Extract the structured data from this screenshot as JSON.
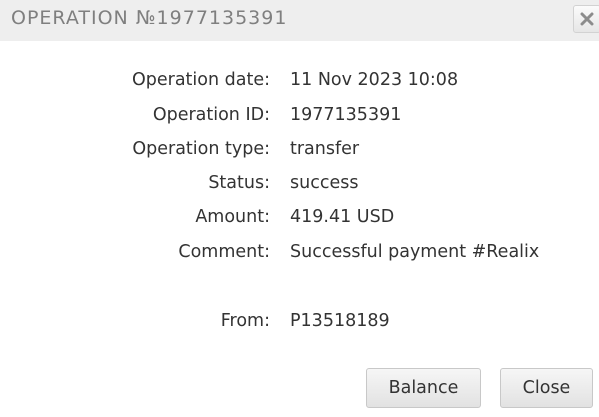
{
  "dialog": {
    "title": "OPERATION №1977135391",
    "close_icon": "close-x-icon"
  },
  "details": [
    {
      "label": "Operation date:",
      "value": "11 Nov 2023 10:08"
    },
    {
      "label": "Operation ID:",
      "value": "1977135391"
    },
    {
      "label": "Operation type:",
      "value": "transfer"
    },
    {
      "label": "Status:",
      "value": "success"
    },
    {
      "label": "Amount:",
      "value": "419.41 USD"
    },
    {
      "label": "Comment:",
      "value": "Successful payment #Realix"
    },
    {
      "label": "From:",
      "value": "P13518189"
    }
  ],
  "buttons": {
    "balance": "Balance",
    "close": "Close"
  }
}
